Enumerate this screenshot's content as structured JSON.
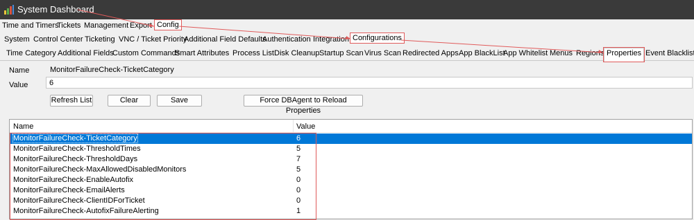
{
  "window": {
    "title": "System Dashboard",
    "icon": "app-icon"
  },
  "menu": {
    "items": [
      "Time and Timers",
      "Tickets",
      "Management",
      "Export",
      "Config"
    ]
  },
  "config_tabs": {
    "items": [
      "System",
      "Control Center",
      "Ticketing",
      "VNC / Ticket Priority",
      "Additional Field Defaults",
      "Authentication",
      "Integration",
      "Configurations"
    ]
  },
  "sub_tabs": {
    "items": [
      "Time Category",
      "Additional Fields",
      "Custom Commands",
      "Smart Attributes",
      "Process List",
      "Disk Cleanup",
      "Startup Scan",
      "Virus Scan",
      "Redirected Apps",
      "App BlackList",
      "App Whitelist",
      "Menus",
      "Regions",
      "Properties",
      "Event Blacklist"
    ],
    "active": "Properties"
  },
  "form": {
    "name_label": "Name",
    "name_value": "MonitorFailureCheck-TicketCategory",
    "value_label": "Value",
    "value_value": "6",
    "refresh_label": "Refresh List",
    "clear_label": "Clear",
    "save_label": "Save",
    "force_label": "Force DBAgent to Reload Properties"
  },
  "table": {
    "columns": [
      "Name",
      "Value"
    ],
    "rows": [
      {
        "name": "MonitorFailureCheck-TicketCategory",
        "value": "6"
      },
      {
        "name": "MonitorFailureCheck-ThresholdTimes",
        "value": "5"
      },
      {
        "name": "MonitorFailureCheck-ThresholdDays",
        "value": "7"
      },
      {
        "name": "MonitorFailureCheck-MaxAllowedDisabledMonitors",
        "value": "5"
      },
      {
        "name": "MonitorFailureCheck-EnableAutofix",
        "value": "0"
      },
      {
        "name": "MonitorFailureCheck-EmailAlerts",
        "value": "0"
      },
      {
        "name": "MonitorFailureCheck-ClientIDForTicket",
        "value": "0"
      },
      {
        "name": "MonitorFailureCheck-AutofixFailureAlerting",
        "value": "1"
      }
    ],
    "selected_index": 0
  },
  "colors": {
    "annotation": "#e05a5a",
    "selection": "#0078d7",
    "titlebar": "#3a3a3a"
  }
}
